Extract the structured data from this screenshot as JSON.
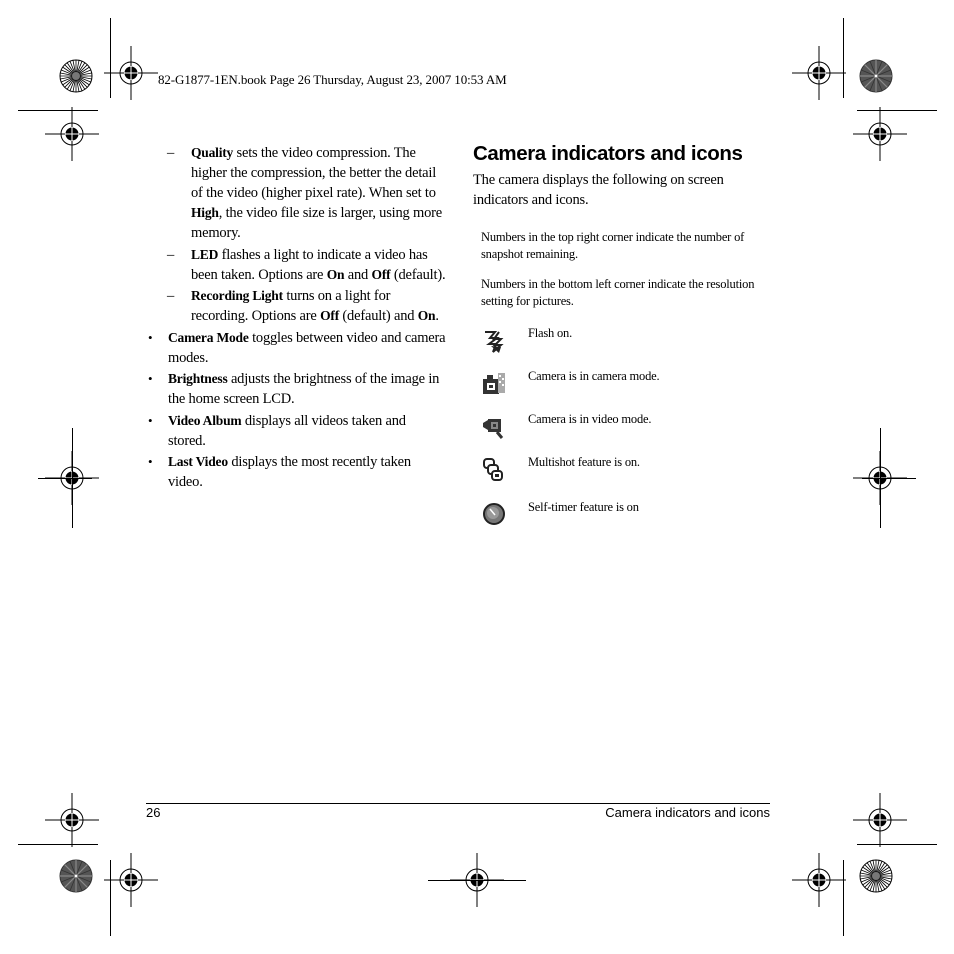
{
  "slug_line": "82-G1877-1EN.book  Page 26  Thursday, August 23, 2007  10:53 AM",
  "left_column": {
    "sub_items": [
      {
        "marker": "–",
        "term": "Quality",
        "segments": [
          {
            "bold": true,
            "text": "Quality"
          },
          {
            "bold": false,
            "text": " sets the video compression. The higher the compression, the better the detail of the video (higher pixel rate). When set to "
          },
          {
            "bold": true,
            "text": "High"
          },
          {
            "bold": false,
            "text": ", the video file size is larger, using more memory."
          }
        ]
      },
      {
        "marker": "–",
        "term": "LED",
        "segments": [
          {
            "bold": true,
            "text": "LED"
          },
          {
            "bold": false,
            "text": " flashes a light to indicate a video has been taken. Options are "
          },
          {
            "bold": true,
            "text": "On"
          },
          {
            "bold": false,
            "text": " and "
          },
          {
            "bold": true,
            "text": "Off"
          },
          {
            "bold": false,
            "text": " (default)."
          }
        ]
      },
      {
        "marker": "–",
        "term": "Recording Light",
        "segments": [
          {
            "bold": true,
            "text": "Recording Light"
          },
          {
            "bold": false,
            "text": " turns on a light for recording. Options are "
          },
          {
            "bold": true,
            "text": "Off"
          },
          {
            "bold": false,
            "text": " (default) and "
          },
          {
            "bold": true,
            "text": "On"
          },
          {
            "bold": false,
            "text": "."
          }
        ]
      }
    ],
    "bullets": [
      {
        "marker": "•",
        "segments": [
          {
            "bold": true,
            "text": "Camera Mode"
          },
          {
            "bold": false,
            "text": " toggles between video and camera modes."
          }
        ]
      },
      {
        "marker": "•",
        "segments": [
          {
            "bold": true,
            "text": "Brightness"
          },
          {
            "bold": false,
            "text": " adjusts the brightness of the image in the home screen LCD."
          }
        ]
      },
      {
        "marker": "•",
        "segments": [
          {
            "bold": true,
            "text": "Video Album"
          },
          {
            "bold": false,
            "text": " displays all videos taken and stored."
          }
        ]
      },
      {
        "marker": "•",
        "segments": [
          {
            "bold": true,
            "text": "Last Video"
          },
          {
            "bold": false,
            "text": " displays the most recently taken video."
          }
        ]
      }
    ]
  },
  "right_column": {
    "heading": "Camera indicators and icons",
    "intro": "The camera displays the following on screen indicators and icons.",
    "notes": [
      "Numbers in the top right corner indicate the number of snapshot remaining.",
      "Numbers in the bottom left corner indicate the resolution setting for pictures."
    ],
    "icons": [
      {
        "icon": "flash-icon",
        "description": "Flash on."
      },
      {
        "icon": "camera-mode-icon",
        "description": "Camera is in camera mode."
      },
      {
        "icon": "video-mode-icon",
        "description": "Camera is in video mode."
      },
      {
        "icon": "multishot-icon",
        "description": "Multishot feature is on."
      },
      {
        "icon": "self-timer-icon",
        "description": "Self-timer feature is on"
      }
    ]
  },
  "footer": {
    "page_number": "26",
    "section_title": "Camera indicators and icons"
  }
}
